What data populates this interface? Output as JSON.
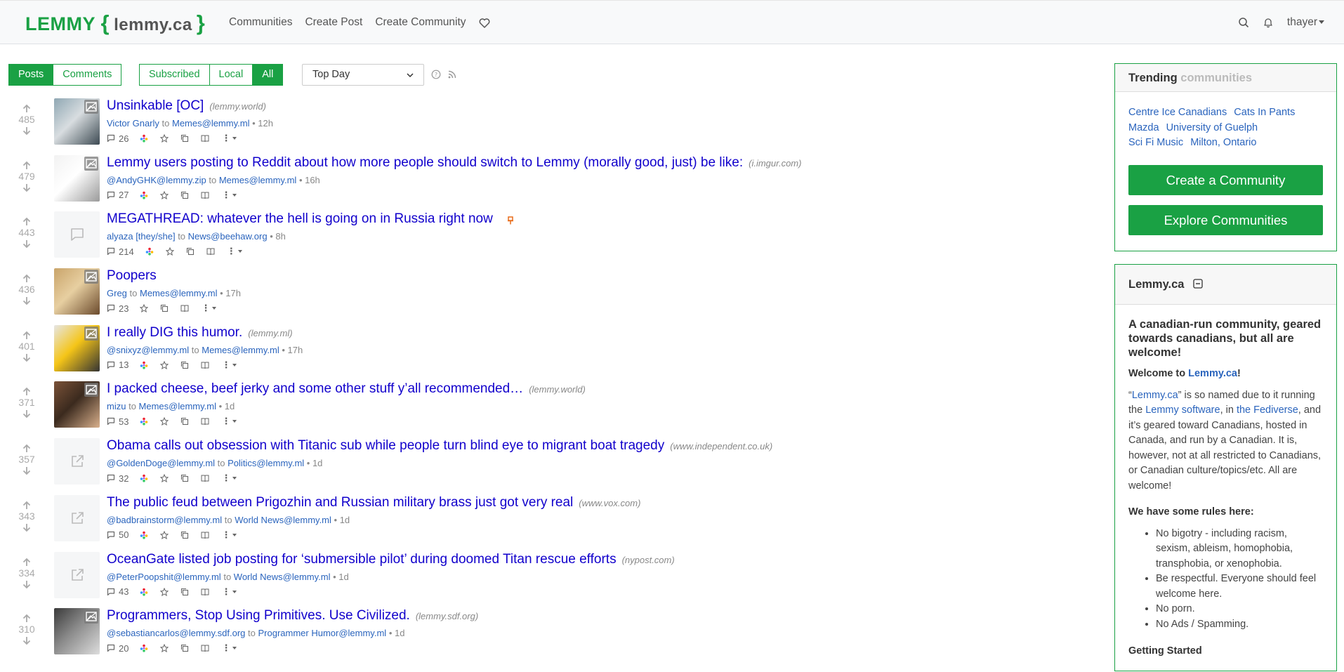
{
  "nav": {
    "brand": "LEMMY",
    "brace_open": "{",
    "site": "lemmy.ca",
    "brace_close": "}",
    "links": [
      "Communities",
      "Create Post",
      "Create Community"
    ],
    "user": "thayer"
  },
  "filters": {
    "type_tabs": [
      "Posts",
      "Comments"
    ],
    "listing_tabs": [
      "Subscribed",
      "Local",
      "All"
    ],
    "active_type": "Posts",
    "active_listing": "All",
    "sort": "Top Day"
  },
  "posts": [
    {
      "score": "485",
      "title": "Unsinkable [OC]",
      "domain": "(lemmy.world)",
      "user": "Victor Gnarly",
      "to": "to",
      "community": "Memes@lemmy.ml",
      "age": "• 12h",
      "comments": "26",
      "thumb": "image"
    },
    {
      "score": "479",
      "title": "Lemmy users posting to Reddit about how more people should switch to Lemmy (morally good, just) be like:",
      "domain": "(i.imgur.com)",
      "user": "@AndyGHK@lemmy.zip",
      "to": "to",
      "community": "Memes@lemmy.ml",
      "age": "• 16h",
      "comments": "27",
      "thumb": "image"
    },
    {
      "score": "443",
      "title": "MEGATHREAD: whatever the hell is going on in Russia right now",
      "domain": "",
      "user": "alyaza [they/she]",
      "to": "to",
      "community": "News@beehaw.org",
      "age": "• 8h",
      "comments": "214",
      "thumb": "text",
      "pinned": true
    },
    {
      "score": "436",
      "title": "Poopers",
      "domain": "",
      "user": "Greg",
      "to": "to",
      "community": "Memes@lemmy.ml",
      "age": "• 17h",
      "comments": "23",
      "thumb": "image"
    },
    {
      "score": "401",
      "title": "I really DIG this humor.",
      "domain": "(lemmy.ml)",
      "user": "@snixyz@lemmy.ml",
      "to": "to",
      "community": "Memes@lemmy.ml",
      "age": "• 17h",
      "comments": "13",
      "thumb": "image"
    },
    {
      "score": "371",
      "title": "I packed cheese, beef jerky and some other stuff y’all recommended…",
      "domain": "(lemmy.world)",
      "user": "mizu",
      "to": "to",
      "community": "Memes@lemmy.ml",
      "age": "• 1d",
      "comments": "53",
      "thumb": "image"
    },
    {
      "score": "357",
      "title": "Obama calls out obsession with Titanic sub while people turn blind eye to migrant boat tragedy",
      "domain": "(www.independent.co.uk)",
      "user": "@GoldenDoge@lemmy.ml",
      "to": "to",
      "community": "Politics@lemmy.ml",
      "age": "• 1d",
      "comments": "32",
      "thumb": "link"
    },
    {
      "score": "343",
      "title": "The public feud between Prigozhin and Russian military brass just got very real",
      "domain": "(www.vox.com)",
      "user": "@badbrainstorm@lemmy.ml",
      "to": "to",
      "community": "World News@lemmy.ml",
      "age": "• 1d",
      "comments": "50",
      "thumb": "link"
    },
    {
      "score": "334",
      "title": "OceanGate listed job posting for ‘submersible pilot’ during doomed Titan rescue efforts",
      "domain": "(nypost.com)",
      "user": "@PeterPoopshit@lemmy.ml",
      "to": "to",
      "community": "World News@lemmy.ml",
      "age": "• 1d",
      "comments": "43",
      "thumb": "link"
    },
    {
      "score": "310",
      "title": "Programmers, Stop Using Primitives. Use Civilized.",
      "domain": "(lemmy.sdf.org)",
      "user": "@sebastiancarlos@lemmy.sdf.org",
      "to": "to",
      "community": "Programmer Humor@lemmy.ml",
      "age": "• 1d",
      "comments": "20",
      "thumb": "image"
    }
  ],
  "sidebar": {
    "trending_label": "Trending",
    "trending_dim": "communities",
    "trending": [
      "Centre Ice Canadians",
      "Cats In Pants",
      "Mazda",
      "University of Guelph",
      "Sci Fi Music",
      "Milton, Ontario"
    ],
    "create_btn": "Create a Community",
    "explore_btn": "Explore Communities",
    "site_name": "Lemmy.ca",
    "tagline": "A canadian-run community, geared towards canadians, but all are welcome!",
    "welcome_prefix": "Welcome to ",
    "welcome_link": "Lemmy.ca",
    "welcome_suffix": "!",
    "desc_1": "“",
    "desc_link1": "Lemmy.ca",
    "desc_2": "” is so named due to it running the ",
    "desc_link2": "Lemmy software",
    "desc_3": ", in ",
    "desc_link3": "the Fediverse",
    "desc_4": ", and it’s geared toward Canadians, hosted in Canada, and run by a Canadian. It is, however, not at all restricted to Canadians, or Canadian culture/topics/etc. All are welcome!",
    "rules_heading": "We have some rules here:",
    "rules": [
      "No bigotry - including racism, sexism, ableism, homophobia, transphobia, or xenophobia.",
      "Be respectful. Everyone should feel welcome here.",
      "No porn.",
      "No Ads / Spamming."
    ],
    "getting_started": "Getting Started"
  }
}
